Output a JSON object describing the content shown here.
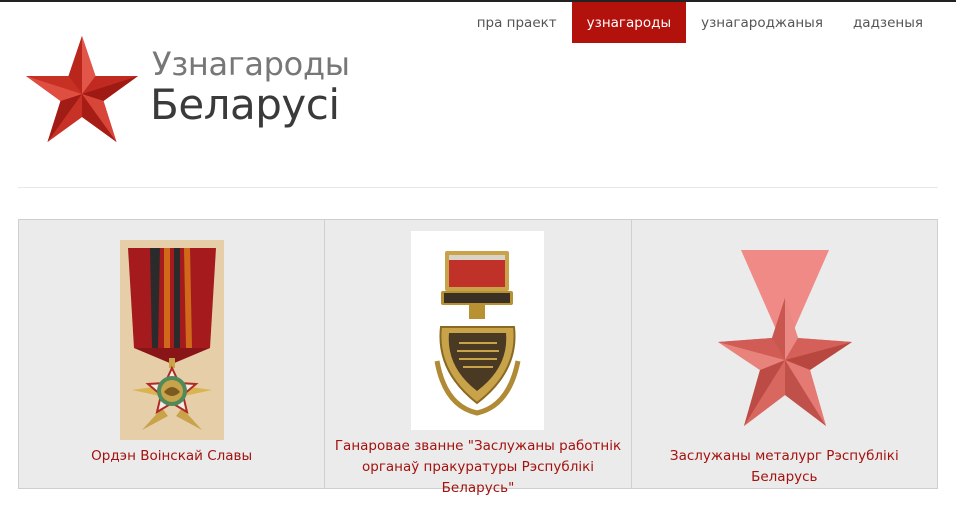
{
  "nav": {
    "items": [
      {
        "label": "пра праект",
        "active": false
      },
      {
        "label": "узнагароды",
        "active": true
      },
      {
        "label": "узнагароджаныя",
        "active": false
      },
      {
        "label": "дадзеныя",
        "active": false
      }
    ],
    "accent_color": "#b3110c"
  },
  "logo": {
    "line1": "Узнагароды",
    "line2": "Беларусі",
    "icon": "red-star-icon"
  },
  "awards": [
    {
      "title": "Ордэн Воінскай Славы",
      "image": "order-military-glory-image"
    },
    {
      "title": "Ганаровае званне \"Заслужаны работнік органаў пракуратуры Рэспублікі Беларусь\"",
      "image": "honored-prosecutor-badge-image"
    },
    {
      "title": "Заслужаны металург Рэспублікі Беларусь",
      "image": "placeholder-star-ribbon-image"
    }
  ],
  "colors": {
    "caption": "#a3120e",
    "card_bg": "#ebebeb"
  }
}
